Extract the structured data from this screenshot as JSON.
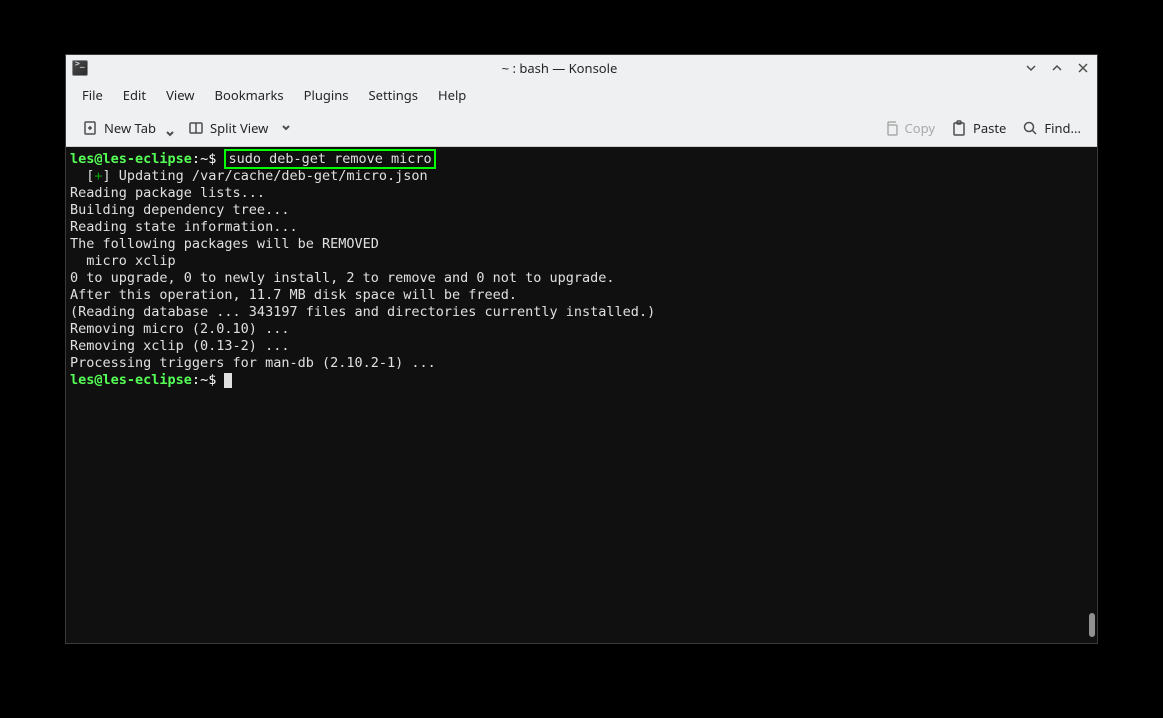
{
  "window": {
    "title": "~ : bash — Konsole"
  },
  "menubar": {
    "items": [
      "File",
      "Edit",
      "View",
      "Bookmarks",
      "Plugins",
      "Settings",
      "Help"
    ]
  },
  "toolbar": {
    "new_tab": "New Tab",
    "split_view": "Split View",
    "copy": "Copy",
    "paste": "Paste",
    "find": "Find..."
  },
  "terminal": {
    "prompt": {
      "user_host": "les@les-eclipse",
      "sep": ":",
      "path": "~",
      "sigil": "$"
    },
    "command_highlighted": "sudo deb-get remove micro",
    "lines": [
      "  [+] Updating /var/cache/deb-get/micro.json",
      "Reading package lists...",
      "Building dependency tree...",
      "Reading state information...",
      "The following packages will be REMOVED",
      "  micro xclip",
      "0 to upgrade, 0 to newly install, 2 to remove and 0 not to upgrade.",
      "After this operation, 11.7 MB disk space will be freed.",
      "(Reading database ... 343197 files and directories currently installed.)",
      "Removing micro (2.0.10) ...",
      "Removing xclip (0.13-2) ...",
      "Processing triggers for man-db (2.10.2-1) ..."
    ]
  }
}
